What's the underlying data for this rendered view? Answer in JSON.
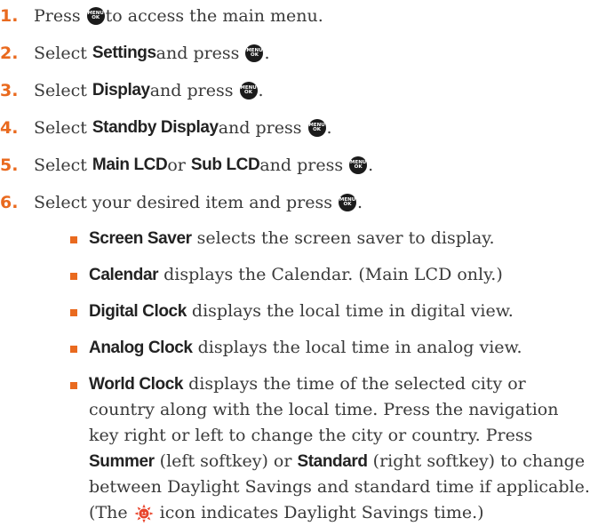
{
  "menu_key_icon": {
    "line1": "MENU",
    "line2": "OK"
  },
  "steps": [
    {
      "num": "1.",
      "t1": "Press ",
      "t2": " to access the main menu."
    },
    {
      "num": "2.",
      "t1": "Select ",
      "b1": "Settings",
      "t2": " and press ",
      "t3": "."
    },
    {
      "num": "3.",
      "t1": "Select ",
      "b1": "Display",
      "t2": " and press ",
      "t3": "."
    },
    {
      "num": "4.",
      "t1": "Select ",
      "b1": "Standby Display",
      "t2": " and press ",
      "t3": "."
    },
    {
      "num": "5.",
      "t1": "Select ",
      "b1": "Main LCD",
      "t2": " or ",
      "b2": "Sub LCD",
      "t3": " and press ",
      "t4": "."
    },
    {
      "num": "6.",
      "t1": "Select your desired item and press ",
      "t2": "."
    }
  ],
  "bullets": [
    {
      "b": "Screen Saver",
      "t": " selects the screen saver to display."
    },
    {
      "b": "Calendar",
      "t": " displays the Calendar. (Main LCD only.)"
    },
    {
      "b": "Digital Clock",
      "t": " displays the local time in digital view."
    },
    {
      "b": "Analog Clock",
      "t": " displays the local time in analog view."
    },
    {
      "b": "World Clock",
      "t1": " displays the time of the selected city or country along with the local time. Press the navigation key right or left to change the city or country. Press ",
      "b2": "Summer",
      "t2": " (left softkey) or ",
      "b3": "Standard",
      "t3": " (right softkey) to change between Daylight Savings and standard time if applicable. (The ",
      "t4": " icon indicates Daylight Savings time.)"
    }
  ],
  "colors": {
    "accent": "#e96a1f",
    "text": "#3a3a3a",
    "key_icon": "#1b1b1b",
    "sun_icon": "#e8432a"
  },
  "icons": {
    "menu_ok": "menu-ok-key-icon",
    "sun": "daylight-savings-sun-icon"
  }
}
